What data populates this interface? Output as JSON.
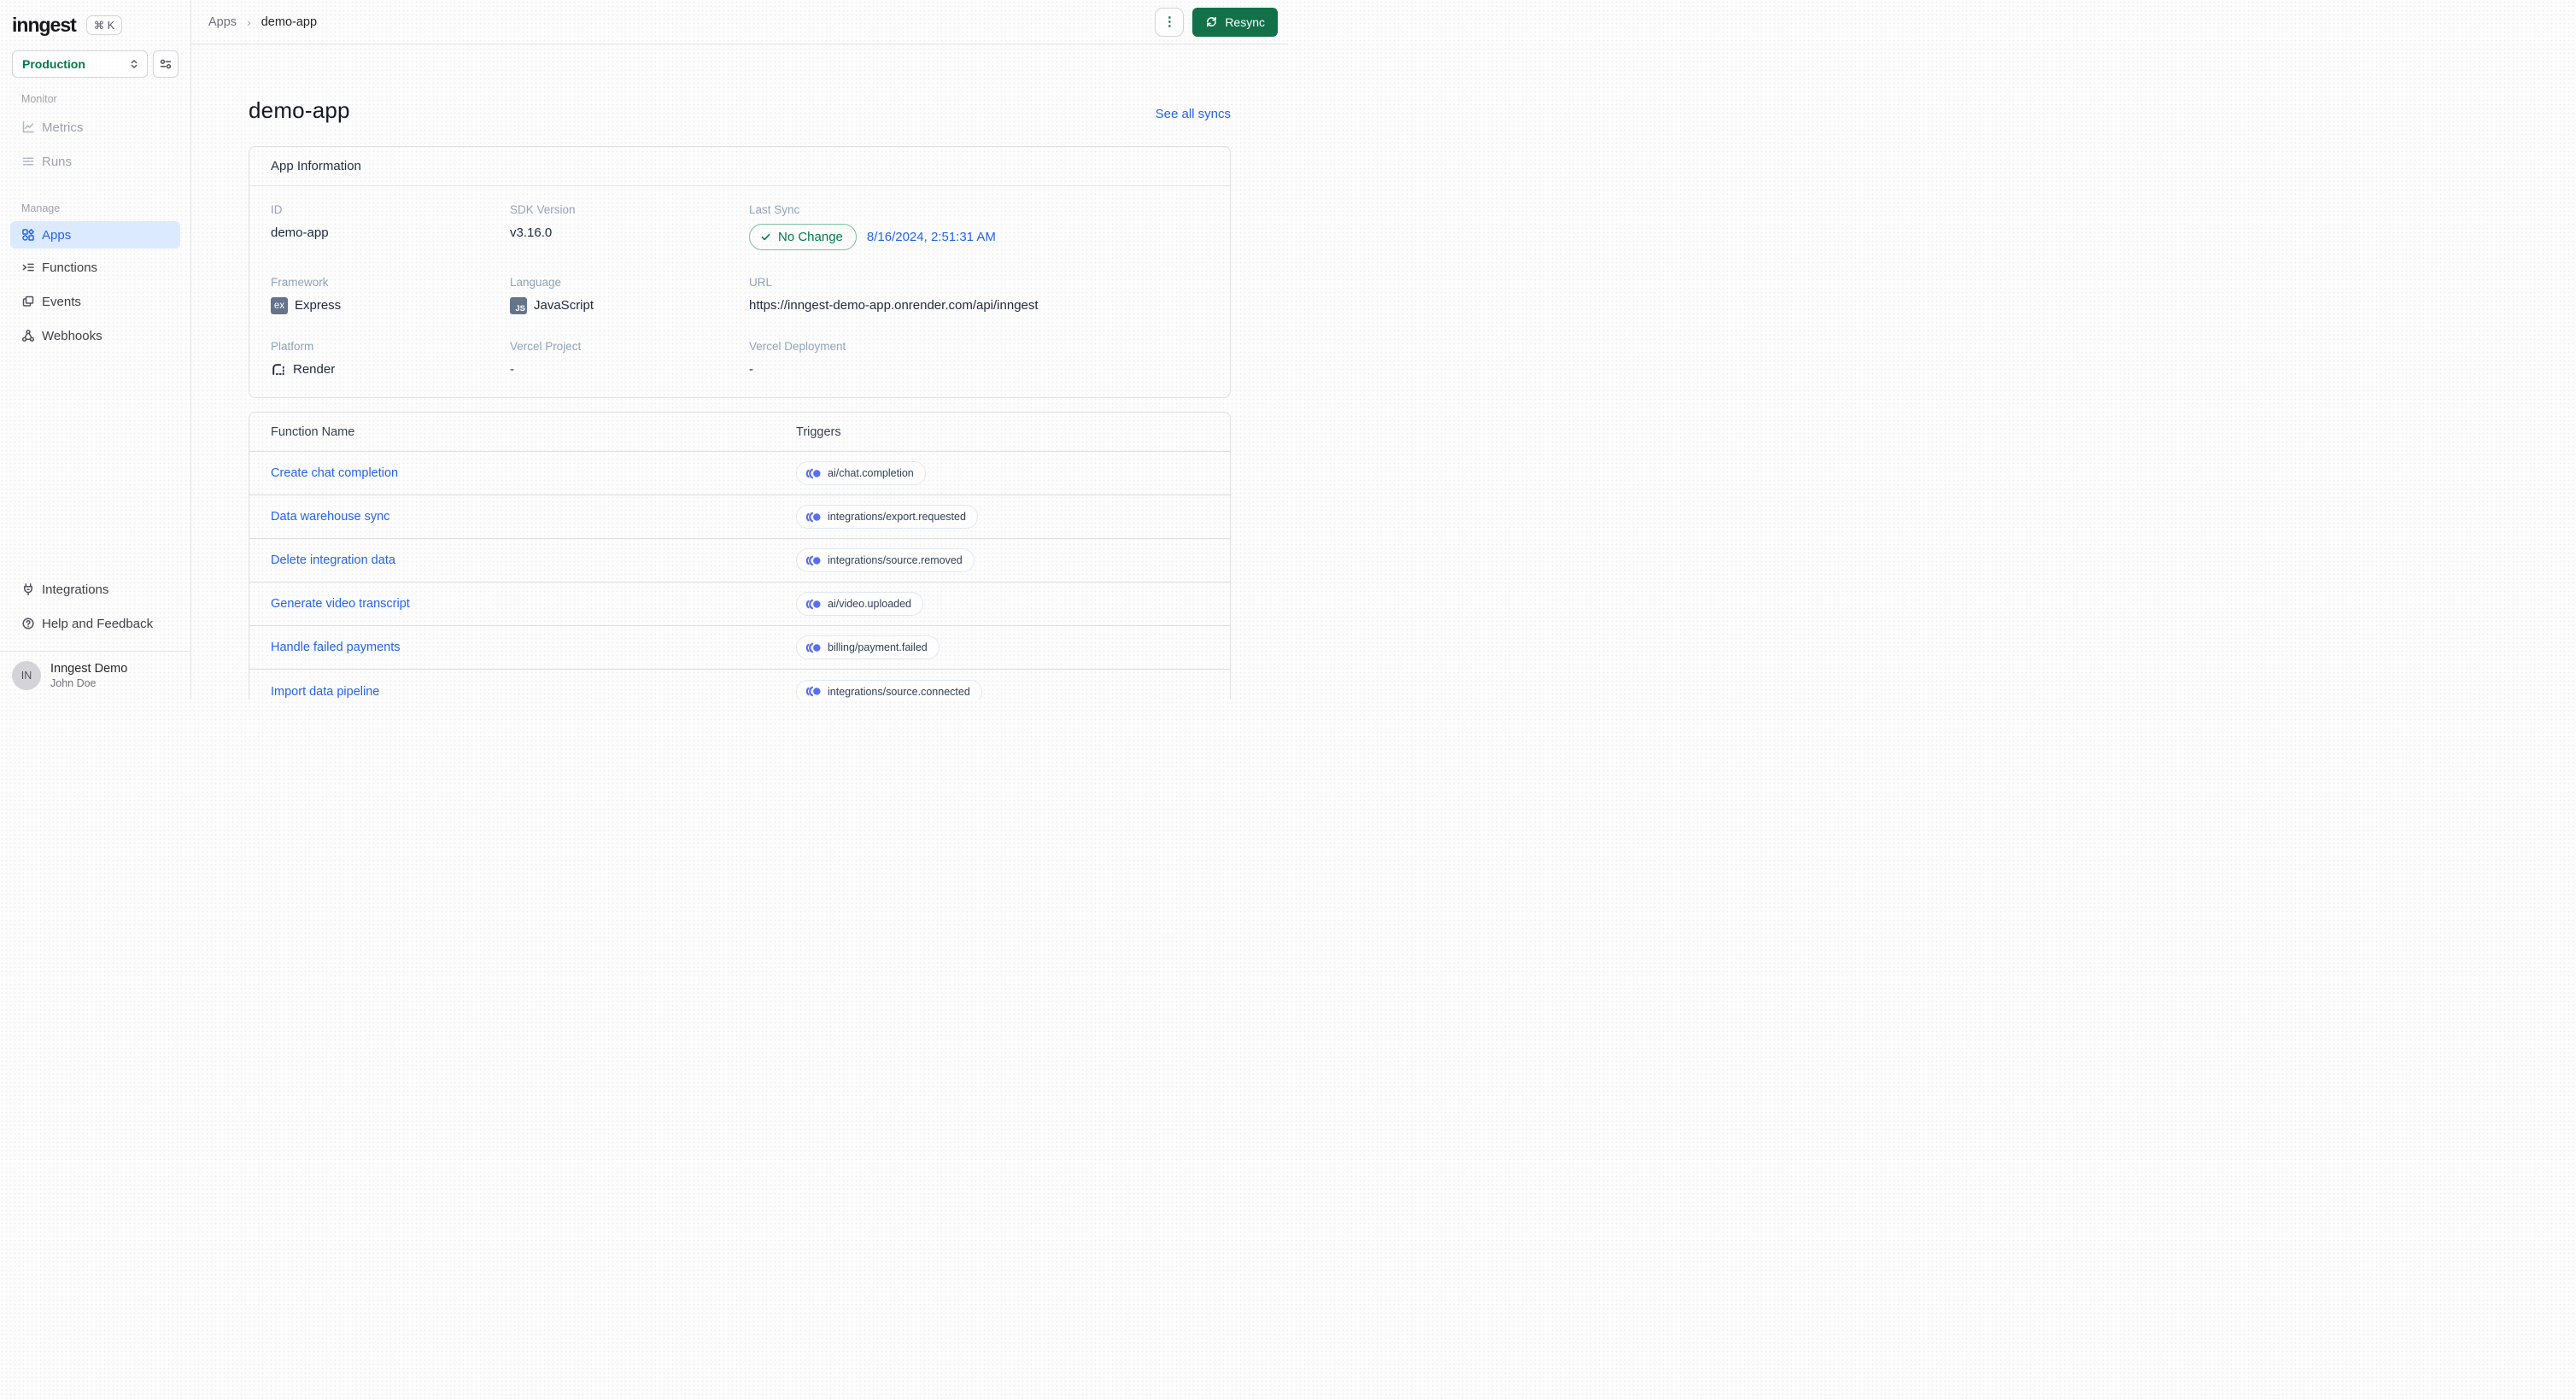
{
  "colors": {
    "accent-green": "#127149",
    "green-text": "#027a48",
    "link-blue": "#2563eb",
    "active-bg": "#dbeafe",
    "trigger-indigo": "#5b6df2",
    "badge-slate": "#64748b",
    "label-gray": "#94a3b8",
    "value-dark": "#1e293b"
  },
  "brand": {
    "logo": "inngest",
    "shortcut": "⌘ K"
  },
  "env_switcher": {
    "value": "Production"
  },
  "sidebar": {
    "sections": [
      {
        "label": "Monitor",
        "items": [
          {
            "label": "Metrics"
          },
          {
            "label": "Runs"
          }
        ]
      },
      {
        "label": "Manage",
        "items": [
          {
            "label": "Apps"
          },
          {
            "label": "Functions"
          },
          {
            "label": "Events"
          },
          {
            "label": "Webhooks"
          }
        ]
      }
    ],
    "footer_items": [
      {
        "label": "Integrations"
      },
      {
        "label": "Help and Feedback"
      }
    ],
    "user": {
      "initials": "IN",
      "org": "Inngest Demo",
      "name": "John Doe"
    }
  },
  "topbar": {
    "breadcrumb": {
      "root": "Apps",
      "current": "demo-app"
    },
    "kebab": "⋮",
    "resync_label": "Resync"
  },
  "page": {
    "title": "demo-app",
    "see_all_label": "See all syncs"
  },
  "app_info": {
    "title": "App Information",
    "id": {
      "label": "ID",
      "value": "demo-app"
    },
    "sdk": {
      "label": "SDK Version",
      "value": "v3.16.0"
    },
    "last_sync": {
      "label": "Last Sync",
      "badge": "No Change",
      "date": "8/16/2024, 2:51:31 AM"
    },
    "framework": {
      "label": "Framework",
      "value": "Express",
      "badge": "ex"
    },
    "language": {
      "label": "Language",
      "value": "JavaScript",
      "badge": "JS"
    },
    "url": {
      "label": "URL",
      "value": "https://inngest-demo-app.onrender.com/api/inngest"
    },
    "platform": {
      "label": "Platform",
      "value": "Render"
    },
    "vercel_project": {
      "label": "Vercel Project",
      "value": "-"
    },
    "vercel_deployment": {
      "label": "Vercel Deployment",
      "value": "-"
    }
  },
  "functions_table": {
    "headers": {
      "name": "Function Name",
      "triggers": "Triggers"
    },
    "rows": [
      {
        "name": "Create chat completion",
        "trigger": "ai/chat.completion"
      },
      {
        "name": "Data warehouse sync",
        "trigger": "integrations/export.requested"
      },
      {
        "name": "Delete integration data",
        "trigger": "integrations/source.removed"
      },
      {
        "name": "Generate video transcript",
        "trigger": "ai/video.uploaded"
      },
      {
        "name": "Handle failed payments",
        "trigger": "billing/payment.failed"
      },
      {
        "name": "Import data pipeline",
        "trigger": "integrations/source.connected"
      }
    ]
  },
  "icons": {
    "shortcut": "command-key",
    "env_button": "sliders",
    "metrics": "line-chart",
    "runs": "list-dashes",
    "apps": "shapes-grid",
    "functions": "chevron-lines",
    "events": "copy-frames",
    "webhooks": "webhook-nodes",
    "integrations": "plug",
    "help": "question-circle",
    "trigger": "event-waves-dot",
    "resync": "refresh-arrows",
    "no_change": "checkmark",
    "platform": "render-corner"
  }
}
